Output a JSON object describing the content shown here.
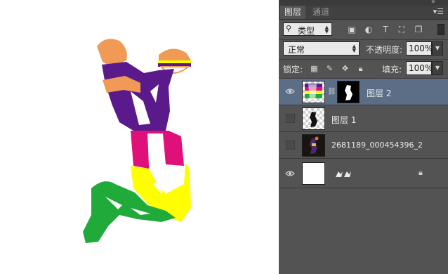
{
  "panel": {
    "collapse_icon": "double-chevron-right-icon",
    "tabs": [
      {
        "label": "图层",
        "active": true
      },
      {
        "label": "通道",
        "active": false
      }
    ],
    "menu_icon": "panel-menu-icon"
  },
  "filter": {
    "kind_label": "类型",
    "icons": [
      "image-filter-icon",
      "adjustment-filter-icon",
      "type-filter-icon",
      "shape-filter-icon",
      "smart-object-filter-icon"
    ]
  },
  "blend": {
    "mode": "正常",
    "opacity_label": "不透明度:",
    "opacity_value": "100%"
  },
  "lock": {
    "label": "锁定:",
    "icons": [
      "lock-transparent-icon",
      "lock-paint-icon",
      "lock-move-icon",
      "lock-all-icon"
    ],
    "fill_label": "填充:",
    "fill_value": "100%"
  },
  "layers": [
    {
      "name": "图层 2",
      "visible": true,
      "selected": true,
      "has_mask": true
    },
    {
      "name": "图层 1",
      "visible": false,
      "selected": false,
      "has_mask": false
    },
    {
      "name": "2681189_000454396_2",
      "visible": false,
      "selected": false,
      "has_mask": false
    },
    {
      "name": "",
      "visible": true,
      "selected": false,
      "locked": true,
      "is_background": true
    }
  ],
  "colors": {
    "panel_bg": "#535353",
    "selected_row": "#5c6e86",
    "purple": "#5b1a8c",
    "magenta": "#e0107a",
    "yellow": "#ffff00",
    "green": "#1faa3a",
    "orange": "#f09a55"
  }
}
